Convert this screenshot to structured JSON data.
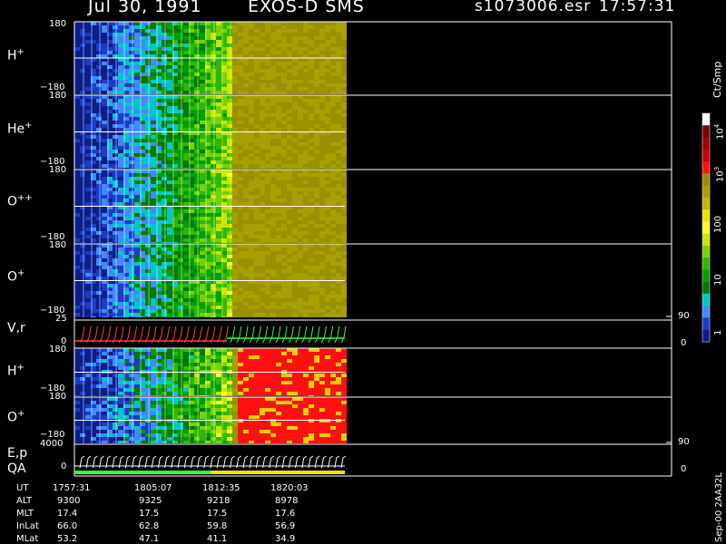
{
  "header": {
    "date": "Jul 30, 1991",
    "instrument": "EXOS-D SMS",
    "file": "s1073006.esr",
    "time": "17:57:31"
  },
  "chart_data": {
    "type": "heatmap",
    "panels": [
      {
        "label": "H",
        "sup": "+",
        "ytop": "180",
        "ybot": "−180",
        "ylim": [
          -180,
          180
        ]
      },
      {
        "label": "He",
        "sup": "+",
        "ytop": "180",
        "ybot": "−180",
        "ylim": [
          -180,
          180
        ]
      },
      {
        "label": "O",
        "sup": "++",
        "ytop": "180",
        "ybot": "−180",
        "ylim": [
          -180,
          180
        ]
      },
      {
        "label": "O",
        "sup": "+",
        "ytop": "180",
        "ybot": "−180",
        "ylim": [
          -180,
          180
        ]
      },
      {
        "label": "V,r",
        "sup": "",
        "ytop": "25",
        "ybot": "0",
        "rtop": "90",
        "rbot": "0"
      },
      {
        "label": "H",
        "sup": "+",
        "ytop": "180",
        "ybot": "−180",
        "ylim": [
          -180,
          180
        ]
      },
      {
        "label": "O",
        "sup": "+",
        "ytop": "180",
        "ybot": "−180",
        "ylim": [
          -180,
          180
        ]
      },
      {
        "label": "E,p",
        "sup": "",
        "label2": "QA",
        "ytop": "4000",
        "ybot": "0",
        "rtop": "90",
        "rbot": "0"
      }
    ],
    "colorbar": {
      "unit": "Ct/Smp",
      "scale": "log",
      "range": [
        1,
        10000
      ],
      "tick_labels": [
        "10",
        "10",
        "100",
        "10",
        "1"
      ],
      "tick_exponents": [
        "4",
        "3",
        "",
        "",
        ""
      ],
      "colors": [
        "#ffffff",
        "#7a0000",
        "#a00000",
        "#c80000",
        "#ff1010",
        "#9a8a00",
        "#a8a000",
        "#bdb800",
        "#e6e600",
        "#ffff30",
        "#c8e600",
        "#7ad200",
        "#2fb800",
        "#00a000",
        "#007a00",
        "#00c8c8",
        "#3c8cff",
        "#1a3cc8",
        "#0a1e8c"
      ]
    },
    "time_axis": [
      "1757:31",
      "1805:07",
      "1812:35",
      "1820:03"
    ]
  },
  "footer": {
    "rows": [
      {
        "name": "UT",
        "values": [
          "1757:31",
          "1805:07",
          "1812:35",
          "1820:03"
        ]
      },
      {
        "name": "ALT",
        "values": [
          "9300",
          "9325",
          "9218",
          "8978"
        ]
      },
      {
        "name": "MLT",
        "values": [
          "17.4",
          "17.5",
          "17.5",
          "17.6"
        ]
      },
      {
        "name": "InLat",
        "values": [
          "66.0",
          "62.8",
          "59.8",
          "56.9"
        ]
      },
      {
        "name": "MLat",
        "values": [
          "53.2",
          "47.1",
          "41.1",
          "34.9"
        ]
      }
    ],
    "stamp": "Sep-00  2AA32L"
  }
}
